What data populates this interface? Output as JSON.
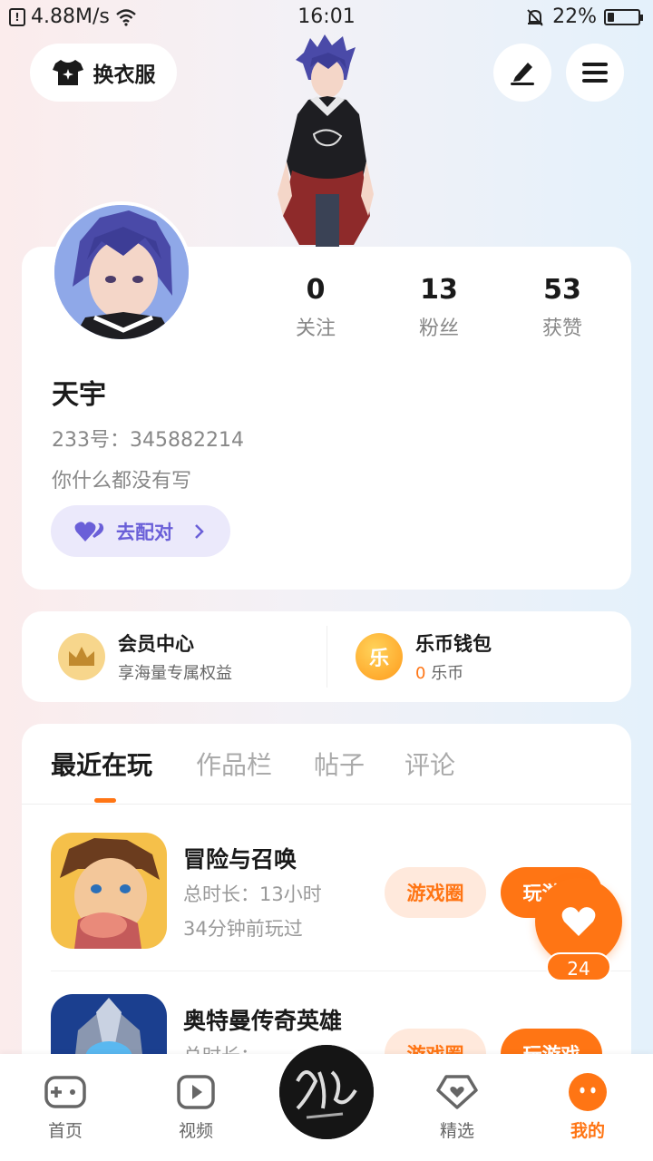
{
  "status_bar": {
    "network_speed": "4.88M/s",
    "time": "16:01",
    "battery": "22%",
    "battery_level": 0.22
  },
  "header": {
    "outfit_label": "换衣服",
    "edit_icon": "edit-icon",
    "menu_icon": "menu-icon"
  },
  "profile": {
    "stats": [
      {
        "value": "0",
        "label": "关注"
      },
      {
        "value": "13",
        "label": "粉丝"
      },
      {
        "value": "53",
        "label": "获赞"
      }
    ],
    "name": "天宇",
    "id_text": "233号：345882214",
    "bio": "你什么都没有写",
    "match_label": "去配对"
  },
  "vip": {
    "member_title": "会员中心",
    "member_sub": "享海量专属权益",
    "wallet_title": "乐币钱包",
    "wallet_amount": "0",
    "wallet_unit": "乐币",
    "coin_char": "乐"
  },
  "tabs": [
    "最近在玩",
    "作品栏",
    "帖子",
    "评论"
  ],
  "games": [
    {
      "name": "冒险与召唤",
      "duration": "总时长：13小时",
      "last_played": "34分钟前玩过",
      "circle_label": "游戏圈",
      "play_label": "玩游戏"
    },
    {
      "name": "奥特曼传奇英雄",
      "duration": "总时长：",
      "last_played": "",
      "circle_label": "游戏圈",
      "play_label": "玩游戏"
    }
  ],
  "floating": {
    "count": "24"
  },
  "bottom_nav": [
    {
      "label": "首页",
      "icon": "gamepad-icon"
    },
    {
      "label": "视频",
      "icon": "video-icon"
    },
    {
      "label": "",
      "icon": "center-avatar"
    },
    {
      "label": "精选",
      "icon": "heart-box-icon"
    },
    {
      "label": "我的",
      "icon": "face-icon"
    }
  ],
  "colors": {
    "accent": "#ff7514",
    "match": "#6a5fd8"
  }
}
